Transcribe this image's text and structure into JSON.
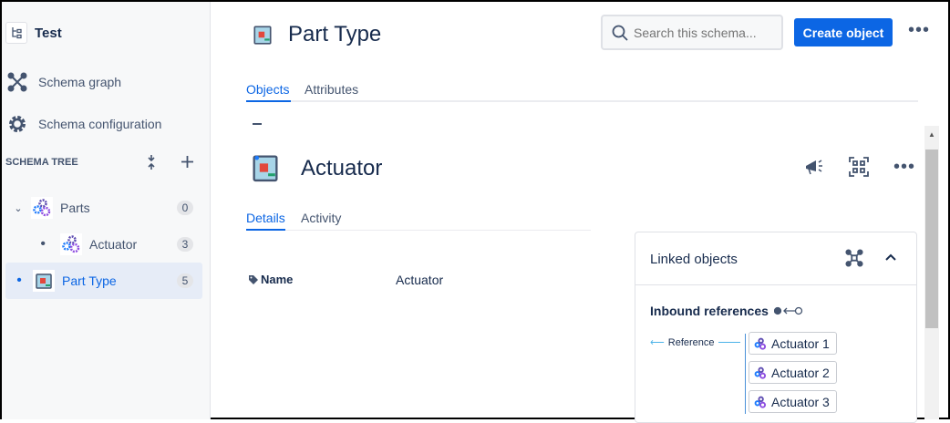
{
  "sidebar": {
    "schema_name": "Test",
    "nav": [
      {
        "label": "Schema graph"
      },
      {
        "label": "Schema configuration"
      }
    ],
    "tree_heading": "SCHEMA TREE",
    "tree": [
      {
        "label": "Parts",
        "count": "0"
      },
      {
        "label": "Actuator",
        "count": "3"
      },
      {
        "label": "Part Type",
        "count": "5"
      }
    ]
  },
  "header": {
    "title": "Part Type",
    "search_placeholder": "Search this schema...",
    "create_label": "Create object"
  },
  "tabs": [
    {
      "label": "Objects"
    },
    {
      "label": "Attributes"
    }
  ],
  "object": {
    "title": "Actuator",
    "tabs": [
      {
        "label": "Details"
      },
      {
        "label": "Activity"
      }
    ],
    "attributes": [
      {
        "name": "Name",
        "value": "Actuator"
      }
    ]
  },
  "linked": {
    "title": "Linked objects",
    "inbound_label": "Inbound references",
    "reference_label": "Reference",
    "items": [
      {
        "label": "Actuator 1"
      },
      {
        "label": "Actuator 2"
      },
      {
        "label": "Actuator 3"
      }
    ]
  },
  "colors": {
    "accent": "#0c66e4"
  }
}
